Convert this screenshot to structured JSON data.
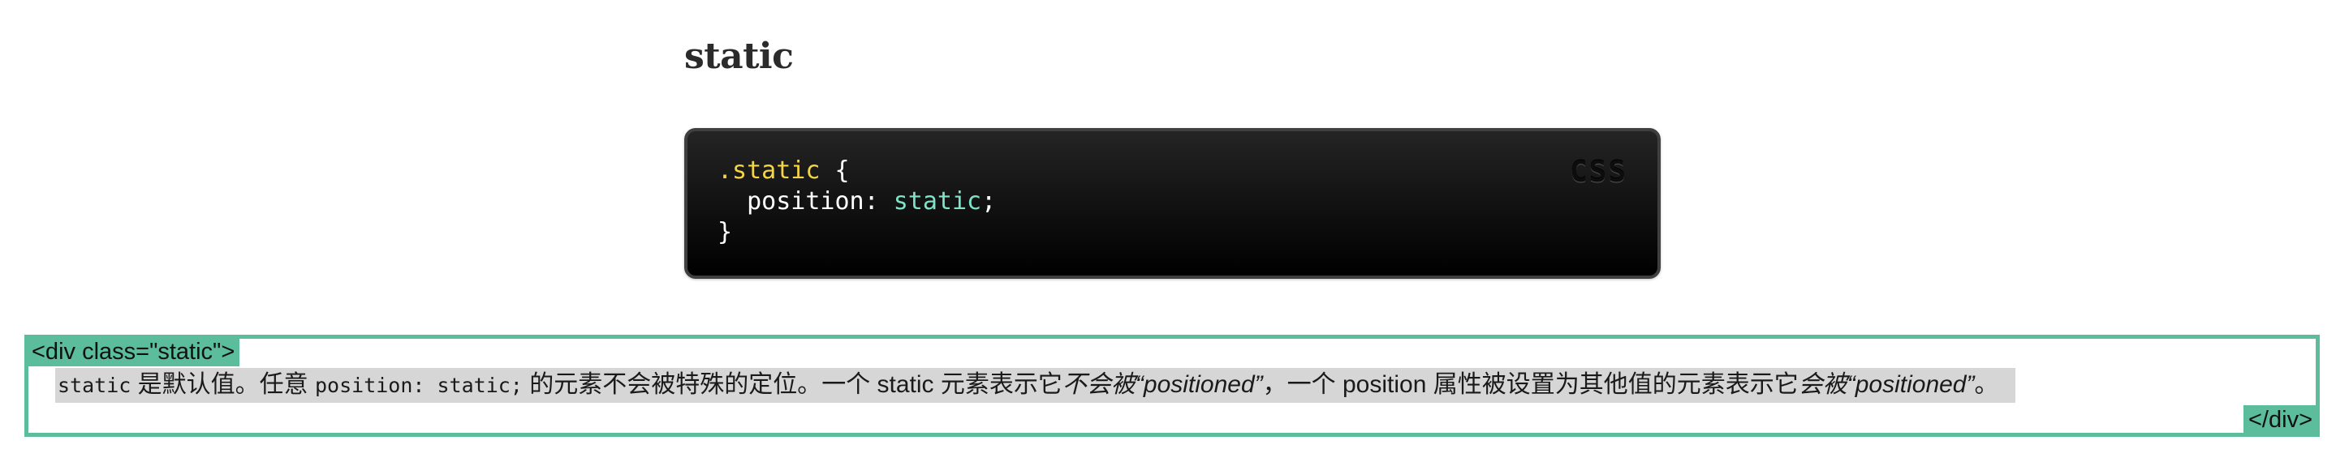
{
  "section": {
    "title": "static"
  },
  "code_block": {
    "language_label": "CSS",
    "line1_selector": ".static",
    "line1_brace": " {",
    "line2_indent": "  ",
    "line2_property": "position: ",
    "line2_value": "static",
    "line2_end": ";",
    "line3": "}",
    "colors": {
      "selector": "#f5d544",
      "value": "#7fe3c8",
      "text": "#ffffff",
      "background": "#000000"
    }
  },
  "demo": {
    "open_tag": "<div class=\"static\">",
    "close_tag": "</div>",
    "border_color": "#5bbd9c",
    "code_static": "static",
    "text_1": " 是默认值。任意 ",
    "code_position": "position: static;",
    "text_2": " 的元素不会被特殊的定位。一个 static 元素表示它",
    "emph_1": "不会被“positioned”",
    "text_3": "，一个 position 属性被设置为其他值的元素表示它",
    "emph_2": "会被“positioned”",
    "text_4": "。"
  }
}
